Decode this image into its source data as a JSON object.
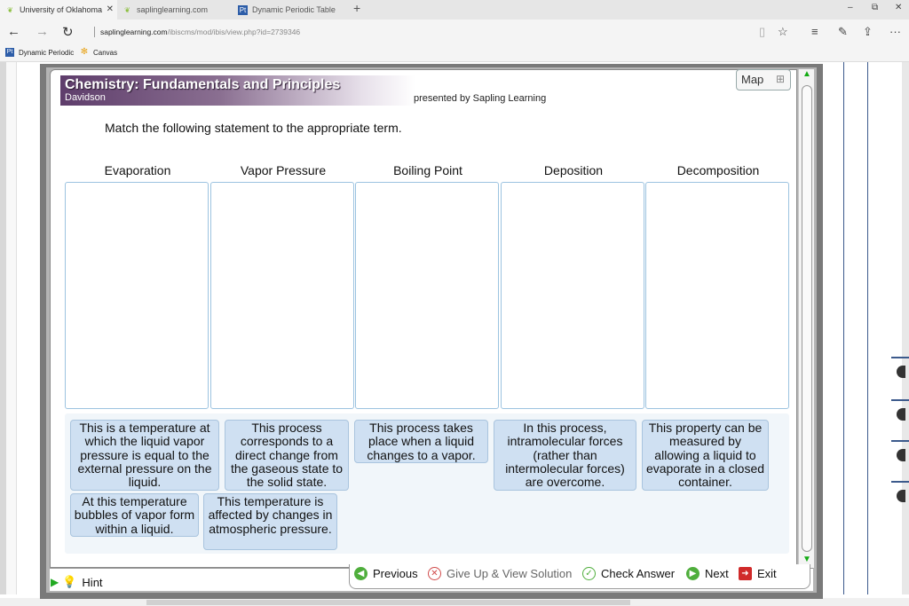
{
  "browser": {
    "tabs": [
      {
        "label": "University of Oklahoma",
        "active": true,
        "icon": "leaf-icon"
      },
      {
        "label": "saplinglearning.com",
        "active": false,
        "icon": "leaf-icon"
      },
      {
        "label": "Dynamic Periodic Table",
        "active": false,
        "icon": "pt-icon"
      }
    ],
    "url_host": "saplinglearning.com",
    "url_path": "/ibiscms/mod/ibis/view.php?id=2739346",
    "favorites": [
      {
        "label": "Dynamic Periodic",
        "icon": "pt-icon"
      },
      {
        "label": "Canvas",
        "icon": "canvas-icon"
      }
    ]
  },
  "header": {
    "title": "Chemistry: Fundamentals and Principles",
    "author": "Davidson",
    "presented_by": "presented by Sapling Learning",
    "map_label": "Map"
  },
  "question": {
    "instruction": "Match the following statement to the appropriate term."
  },
  "bins": [
    {
      "label": "Evaporation"
    },
    {
      "label": "Vapor Pressure"
    },
    {
      "label": "Boiling Point"
    },
    {
      "label": "Deposition"
    },
    {
      "label": "Decomposition"
    }
  ],
  "cards": [
    {
      "text": "This is a temperature at which the liquid vapor pressure is equal to the external pressure on the liquid."
    },
    {
      "text": "This process corresponds to a direct change from the gaseous state to the solid state."
    },
    {
      "text": "This process takes place when a liquid changes to a vapor."
    },
    {
      "text": "In this process, intramolecular forces (rather than intermolecular forces) are overcome."
    },
    {
      "text": "This property can be measured by allowing a liquid to evaporate in a closed container."
    },
    {
      "text": "At this temperature bubbles of vapor form within a liquid."
    },
    {
      "text": "This temperature is affected by changes in atmospheric pressure."
    }
  ],
  "footer": {
    "hint": "Hint",
    "previous": "Previous",
    "give_up": "Give Up & View Solution",
    "check": "Check Answer",
    "next": "Next",
    "exit": "Exit"
  },
  "colors": {
    "banner": "#5e3d6b",
    "card_fill": "#cfe0f2",
    "bin_border": "#9cc3e0",
    "scroll_arrow": "#11aa11"
  }
}
